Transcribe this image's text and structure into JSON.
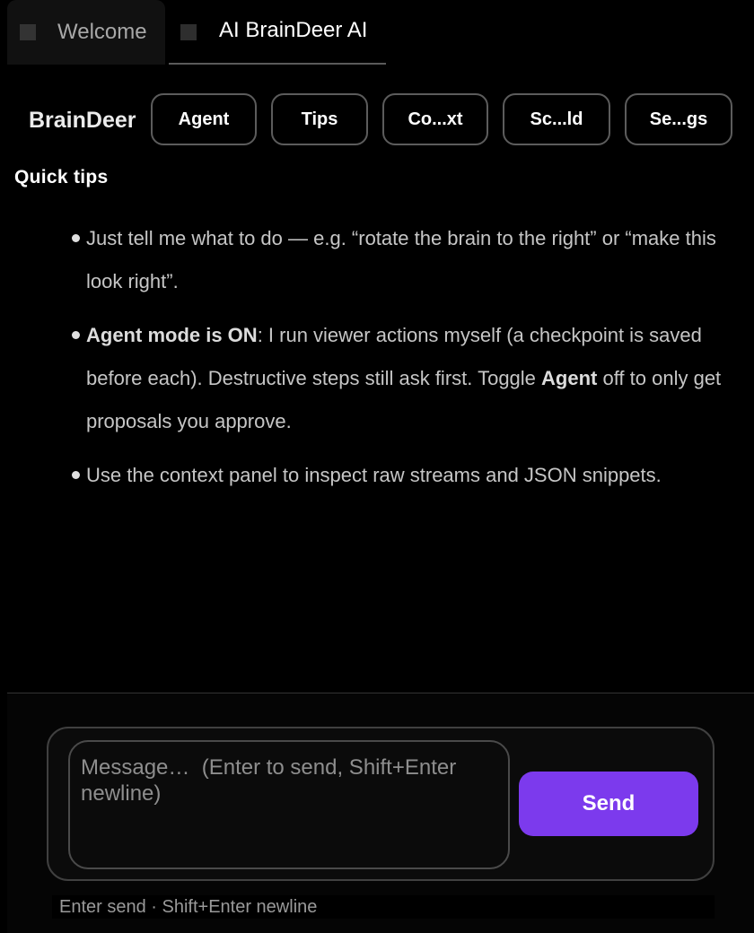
{
  "tabs": [
    {
      "label": "Welcome",
      "active": false
    },
    {
      "label": "AI BrainDeer AI",
      "active": true
    }
  ],
  "toolbar": {
    "brand": "BrainDeer",
    "buttons": {
      "agent": "Agent",
      "tips": "Tips",
      "context": "Co...xt",
      "scaffold": "Sc...ld",
      "settings": "Se...gs"
    }
  },
  "tips": {
    "title": "Quick tips",
    "items": [
      {
        "text": "Just tell me what to do — e.g. “rotate the brain to the right” or “make this look right”."
      },
      {
        "bold1": "Agent mode is ON",
        "text1": ": I run viewer actions myself (a checkpoint is saved before each). Destructive steps still ask first. Toggle ",
        "bold2": "Agent",
        "text2": " off to only get proposals you approve."
      },
      {
        "text": "Use the context panel to inspect raw streams and JSON snippets."
      }
    ]
  },
  "composer": {
    "placeholder": "Message…  (Enter to send, Shift+Enter newline)",
    "send_label": "Send",
    "hint": "Enter send · Shift+Enter newline"
  },
  "colors": {
    "accent": "#7c3aed",
    "background": "#000000"
  }
}
